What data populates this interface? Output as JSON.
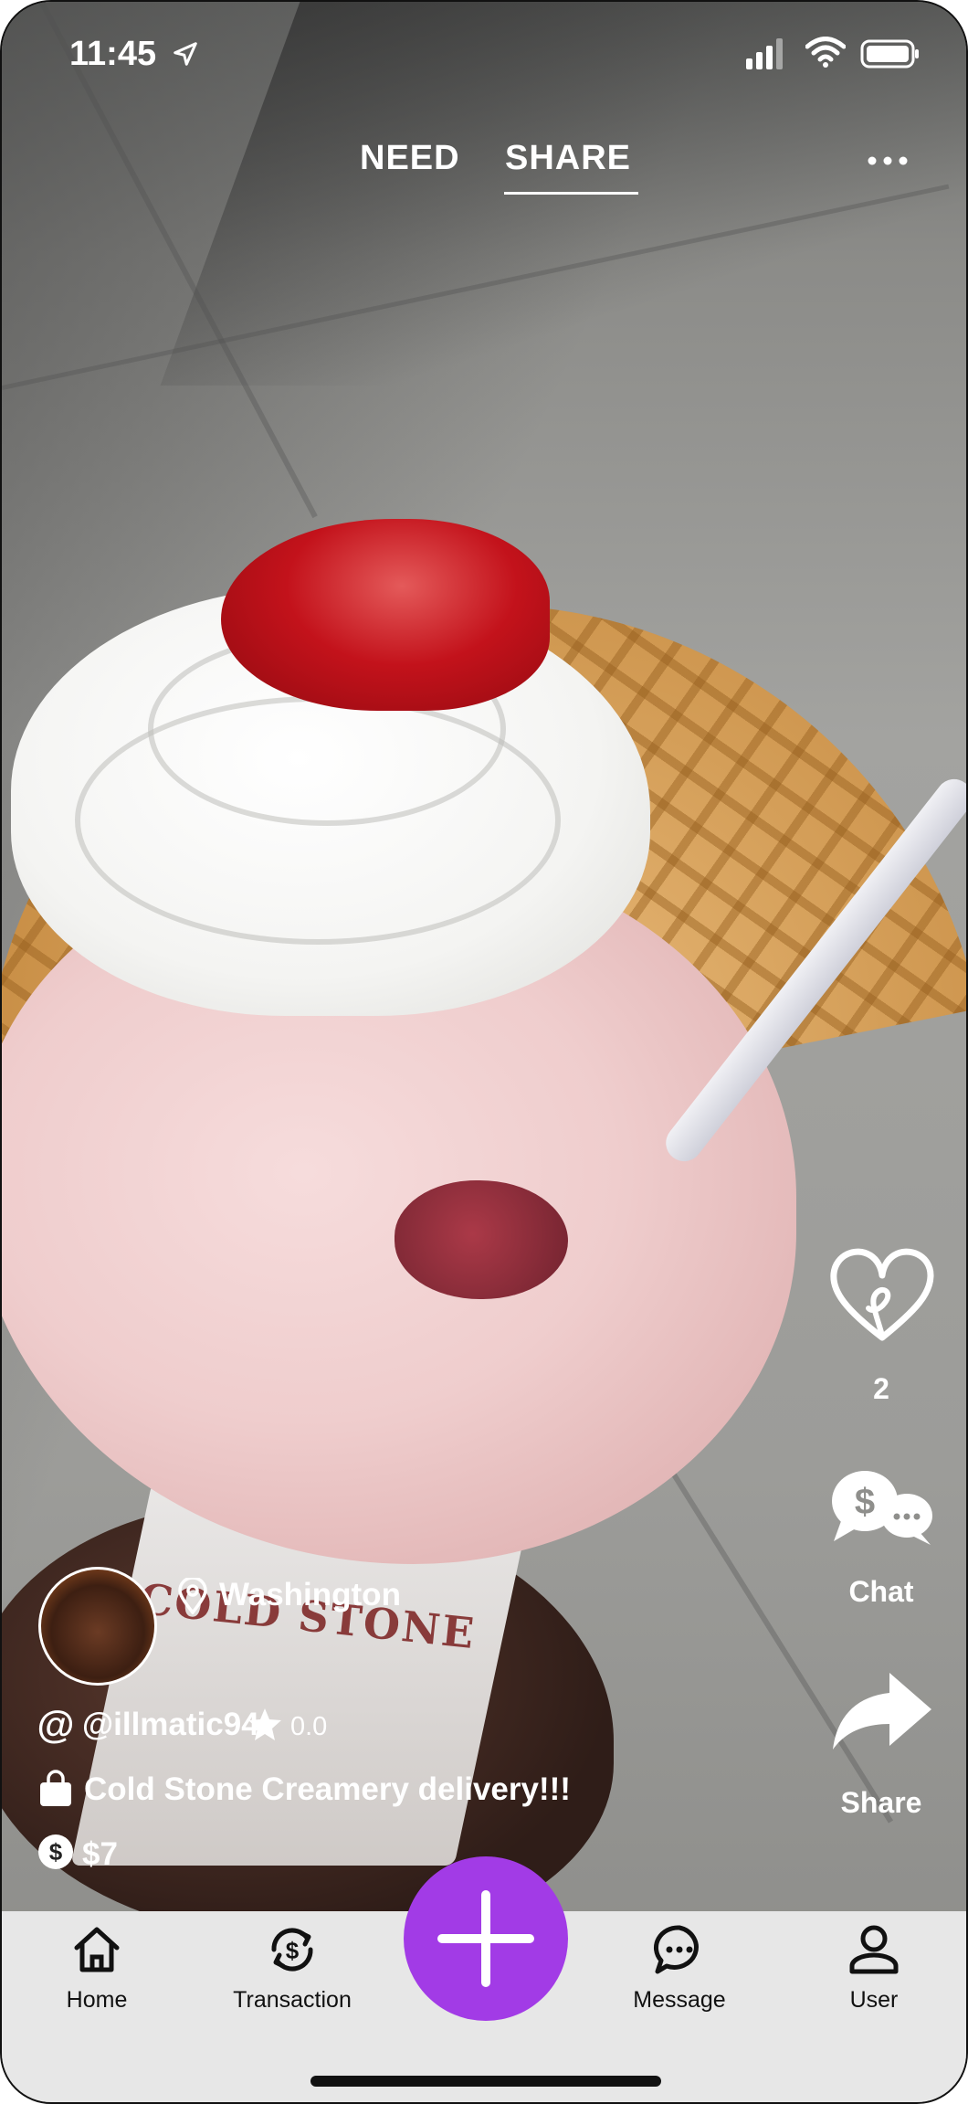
{
  "status_bar": {
    "time": "11:45"
  },
  "top_tabs": {
    "need": "NEED",
    "share": "SHARE",
    "active": "share"
  },
  "right_rail": {
    "like_count": "2",
    "chat_label": "Chat",
    "share_label": "Share"
  },
  "post": {
    "location": "Washington",
    "username": "@illmatic94",
    "rating": "0.0",
    "title": "Cold Stone Creamery delivery!!!",
    "price": "$7"
  },
  "photo": {
    "cup_print": "COLD STONE"
  },
  "bottom_nav": {
    "home": "Home",
    "transaction": "Transaction",
    "message": "Message",
    "user": "User"
  },
  "colors": {
    "accent": "#a23be6",
    "nav_bg": "#e7e7e7"
  },
  "icons": [
    "location-arrow-icon",
    "signal-icon",
    "wifi-icon",
    "battery-icon",
    "more-icon",
    "heart-icon",
    "chat-dollar-icon",
    "share-arrow-icon",
    "location-pin-icon",
    "at-icon",
    "star-icon",
    "bag-icon",
    "dollar-coin-icon",
    "home-icon",
    "transaction-icon",
    "plus-icon",
    "message-icon",
    "user-icon"
  ]
}
